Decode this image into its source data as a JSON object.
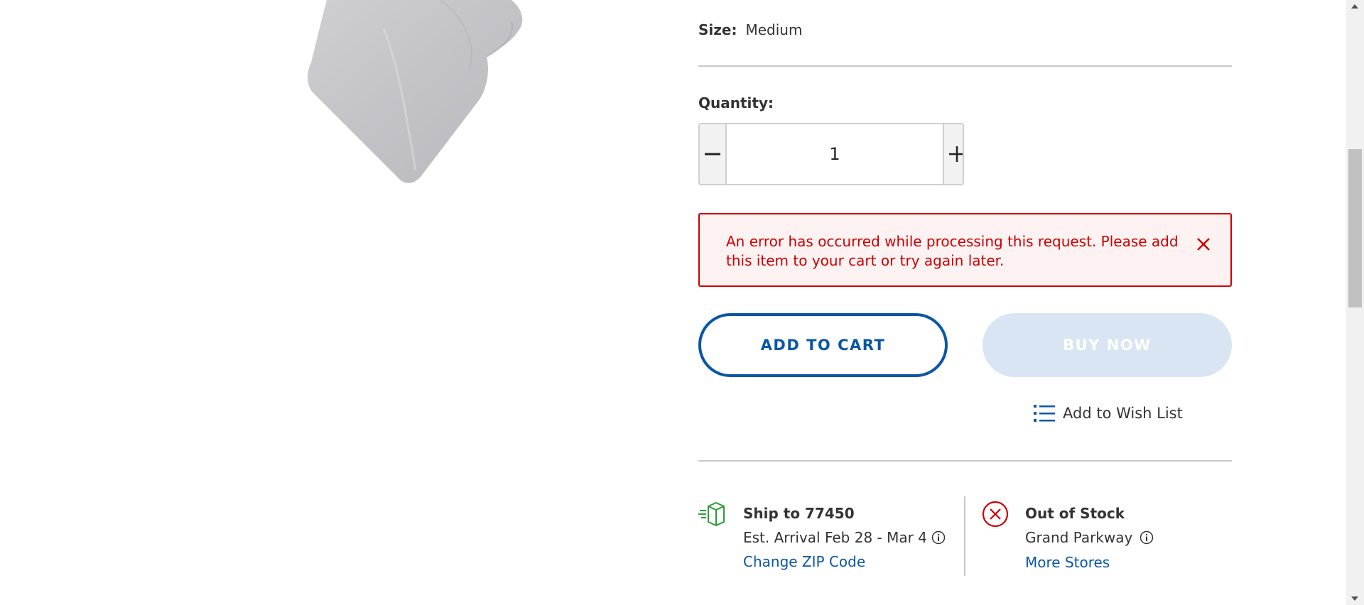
{
  "size": {
    "label": "Size:",
    "value": "Medium"
  },
  "quantity": {
    "label": "Quantity:",
    "value": "1"
  },
  "error": {
    "message": "An error has occurred while processing this request. Please add this item to your cart or try again later."
  },
  "actions": {
    "add_to_cart": "ADD TO CART",
    "buy_now": "BUY NOW",
    "wish_list": "Add to Wish List"
  },
  "shipping": {
    "title": "Ship to 77450",
    "estimate": "Est. Arrival Feb 28 - Mar 4",
    "link": "Change ZIP Code",
    "icon": "package-shipping-icon"
  },
  "pickup": {
    "title": "Out of Stock",
    "store": "Grand Parkway",
    "link": "More Stores",
    "icon": "circle-x-icon"
  },
  "colors": {
    "accent": "#0a56a6",
    "error": "#cc0000",
    "error_bg": "#fdf2f2",
    "ship_icon": "#2a9d3a",
    "disabled_button": "#d9e5f2"
  }
}
